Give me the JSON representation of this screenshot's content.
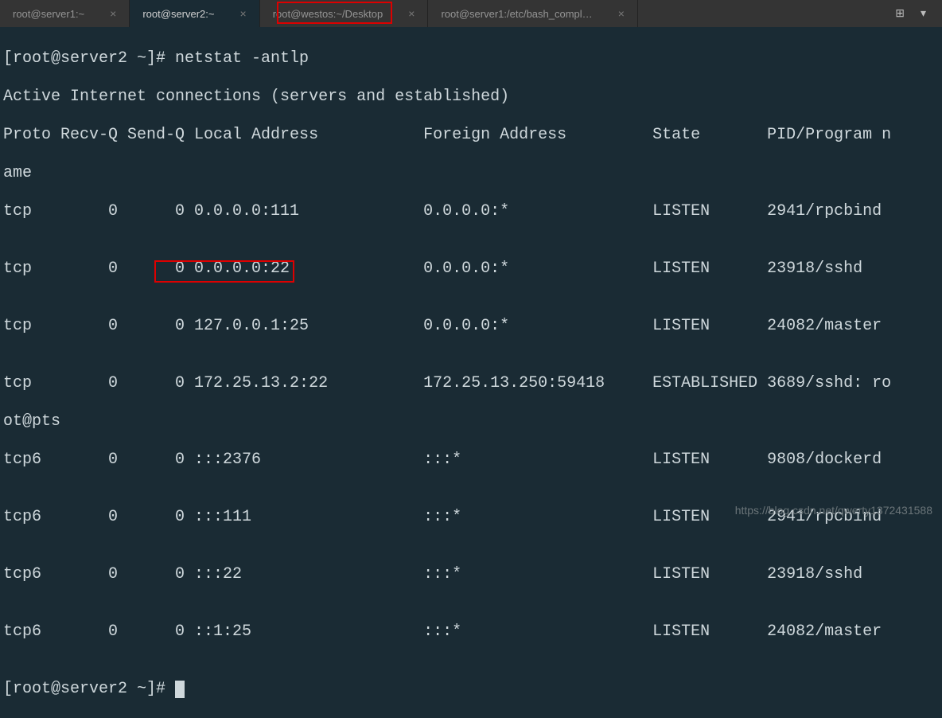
{
  "tabs": [
    {
      "label": "root@server1:~"
    },
    {
      "label": "root@server2:~"
    },
    {
      "label": "root@westos:~/Desktop"
    },
    {
      "label": "root@server1:/etc/bash_compl…"
    }
  ],
  "prompt1": "[root@server2 ~]# netstat -antlp",
  "header_line": "Active Internet connections (servers and established)",
  "columns_line1": "Proto Recv-Q Send-Q Local Address           Foreign Address         State       PID/Program n",
  "columns_line2": "ame",
  "rows": [
    "tcp        0      0 0.0.0.0:111             0.0.0.0:*               LISTEN      2941/rpcbind",
    "",
    "tcp        0      0 0.0.0.0:22              0.0.0.0:*               LISTEN      23918/sshd",
    "",
    "tcp        0      0 127.0.0.1:25            0.0.0.0:*               LISTEN      24082/master",
    "",
    "tcp        0      0 172.25.13.2:22          172.25.13.250:59418     ESTABLISHED 3689/sshd: ro",
    "ot@pts",
    "tcp6       0      0 :::2376                 :::*                    LISTEN      9808/dockerd",
    "",
    "tcp6       0      0 :::111                  :::*                    LISTEN      2941/rpcbind",
    "",
    "tcp6       0      0 :::22                   :::*                    LISTEN      23918/sshd",
    "",
    "tcp6       0      0 ::1:25                  :::*                    LISTEN      24082/master",
    ""
  ],
  "prompt2": "[root@server2 ~]# ",
  "watermark": "https://blog.csdn.net/qwerty1372431588"
}
